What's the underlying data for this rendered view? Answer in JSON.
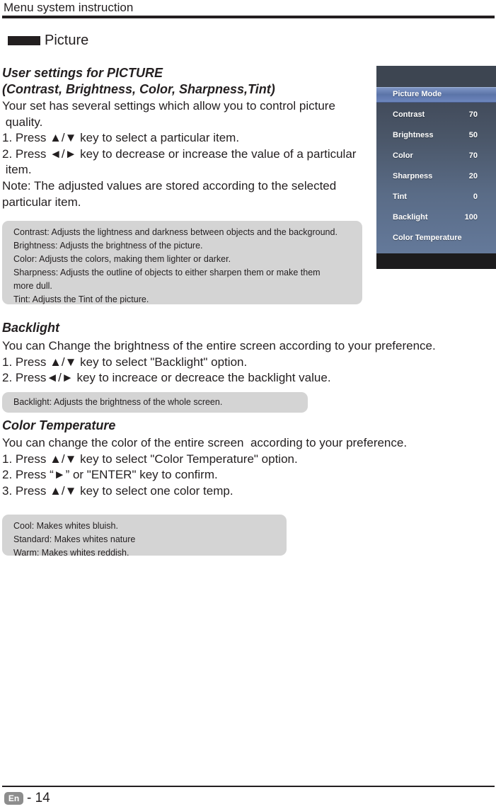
{
  "header": {
    "title": "Menu system instruction"
  },
  "section": {
    "title": "Picture"
  },
  "picture_settings": {
    "heading_line1": "User settings for PICTURE",
    "heading_line2": "(Contrast, Brightness, Color, Sharpness,Tint)",
    "paragraph": "Your set has several settings which allow you to control picture\n quality.\n1. Press ▲/▼ key to select a particular item.\n2. Press ◄/► key to decrease or increase the value of a particular\n item.\nNote: The adjusted values are stored according to the selected\nparticular item.",
    "note": "Contrast: Adjusts the lightness and darkness between objects and the background.\nBrightness: Adjusts the brightness of the picture.\nColor: Adjusts the colors, making them lighter or darker.\nSharpness: Adjusts the outline of objects to either sharpen them or make them\nmore dull.\nTint: Adjusts the Tint of the picture."
  },
  "backlight": {
    "heading": "Backlight",
    "paragraph": "You can Change the brightness of the entire screen according to your preference.\n1. Press ▲/▼ key to select \"Backlight\" option.\n2. Press◄/► key to increace or decreace the backlight value.",
    "note": "Backlight: Adjusts the brightness of the whole screen."
  },
  "color_temperature": {
    "heading": "Color Temperature",
    "paragraph": "You can change the color of the entire screen  according to your preference.\n1. Press ▲/▼ key to select \"Color Temperature\" option.\n2. Press “►” or \"ENTER\" key to confirm.\n3. Press ▲/▼ key to select one color temp.",
    "note": "Cool: Makes whites bluish.\nStandard: Makes whites nature\nWarm: Makes whites reddish."
  },
  "osd": {
    "rows": [
      {
        "label": "Picture Mode",
        "value": "",
        "highlight": true
      },
      {
        "label": "Contrast",
        "value": "70",
        "highlight": false
      },
      {
        "label": "Brightness",
        "value": "50",
        "highlight": false
      },
      {
        "label": "Color",
        "value": "70",
        "highlight": false
      },
      {
        "label": "Sharpness",
        "value": "20",
        "highlight": false
      },
      {
        "label": "Tint",
        "value": "0",
        "highlight": false
      },
      {
        "label": "Backlight",
        "value": "100",
        "highlight": false
      },
      {
        "label": "Color Temperature",
        "value": "",
        "highlight": false
      }
    ],
    "highlight_color": "#5b74a8",
    "panel_color": "#4a5668"
  },
  "footer": {
    "language_badge": "En",
    "page": "- 14"
  }
}
